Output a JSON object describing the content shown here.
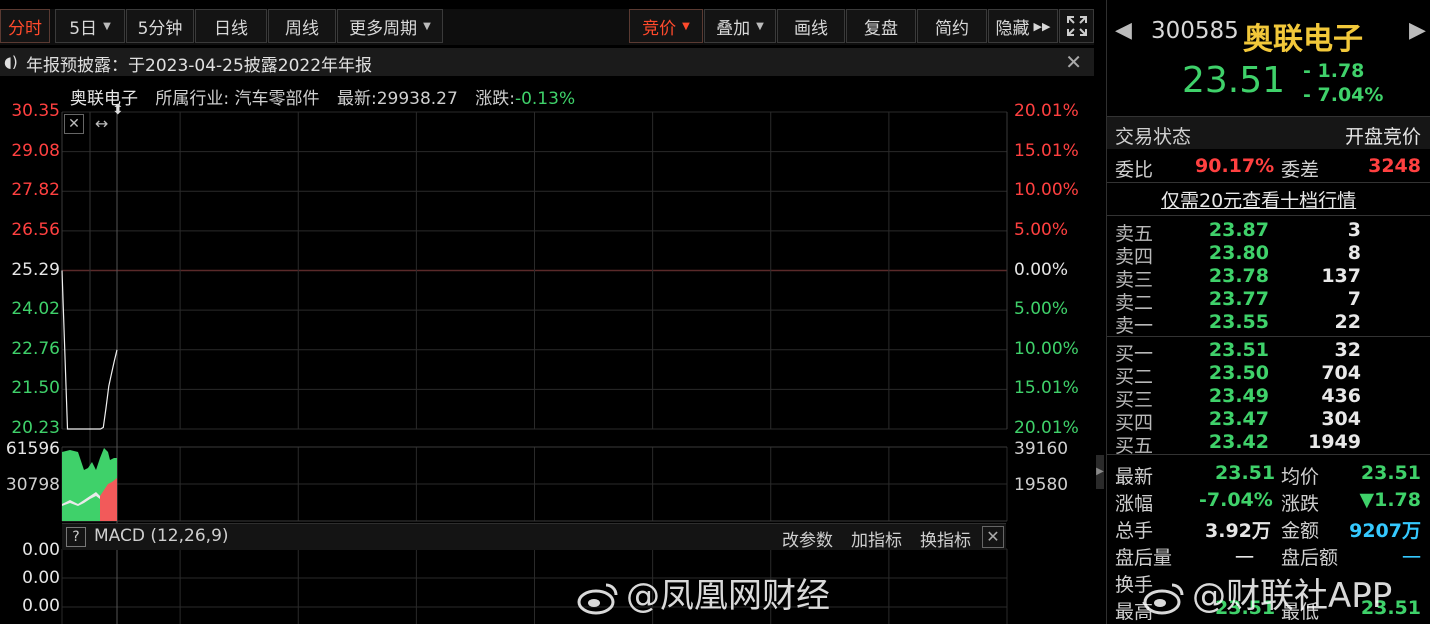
{
  "toolbar": {
    "tabs": [
      "分时",
      "5日",
      "5分钟",
      "日线",
      "周线",
      "更多周期"
    ],
    "right": [
      "竞价",
      "叠加",
      "画线",
      "复盘",
      "简约",
      "隐藏"
    ]
  },
  "notice": {
    "text": "年报预披露：于2023-04-25披露2022年年报"
  },
  "chart_header": {
    "name": "奥联电子",
    "industry_label": "所属行业:",
    "industry": "汽车零部件",
    "latest_label": "最新:",
    "latest": "29938.27",
    "change_label": "涨跌:",
    "change": "-0.13%"
  },
  "chart_data": [
    {
      "type": "line",
      "title": "",
      "y_left_ticks": [
        "30.35",
        "29.08",
        "27.82",
        "26.56",
        "25.29",
        "24.02",
        "22.76",
        "21.50",
        "20.23"
      ],
      "y_right_ticks": [
        "20.01%",
        "15.01%",
        "10.00%",
        "5.00%",
        "0.00%",
        "5.00%",
        "10.00%",
        "15.01%",
        "20.01%"
      ],
      "ylim": [
        20.23,
        30.35
      ],
      "series": [
        {
          "x": [
            0,
            0.02,
            0.04,
            0.06,
            0.08,
            0.1,
            0.11,
            0.12,
            0.13,
            0.14,
            0.15,
            0.16,
            0.17,
            0.18,
            0.19,
            0.2
          ],
          "values": [
            25.29,
            20.23,
            20.23,
            20.23,
            20.23,
            20.23,
            20.23,
            20.23,
            20.23,
            20.23,
            20.28,
            20.9,
            21.6,
            22.0,
            22.4,
            22.76
          ]
        }
      ]
    },
    {
      "type": "area",
      "title": "",
      "y_left_ticks": [
        "61596",
        "30798"
      ],
      "y_right_ticks": [
        "39160",
        "19580"
      ]
    },
    {
      "type": "line",
      "title": "MACD (12,26,9)",
      "y_left_ticks": [
        "0.00",
        "0.00",
        "0.00"
      ]
    }
  ],
  "macd": {
    "help": "?",
    "title": "MACD (12,26,9)",
    "buttons": [
      "改参数",
      "加指标",
      "换指标"
    ]
  },
  "panel": {
    "code": "300585",
    "name": "奥联电子",
    "price": "23.51",
    "change": "- 1.78",
    "change_pct": "- 7.04%",
    "status_label": "交易状态",
    "status": "开盘竞价",
    "weibi_label": "委比",
    "weibi": "90.17%",
    "weicha_label": "委差",
    "weicha": "3248",
    "promo": "仅需20元查看十档行情",
    "asks": [
      {
        "name": "卖五",
        "price": "23.87",
        "vol": "3"
      },
      {
        "name": "卖四",
        "price": "23.80",
        "vol": "8"
      },
      {
        "name": "卖三",
        "price": "23.78",
        "vol": "137"
      },
      {
        "name": "卖二",
        "price": "23.77",
        "vol": "7"
      },
      {
        "name": "卖一",
        "price": "23.55",
        "vol": "22"
      }
    ],
    "bids": [
      {
        "name": "买一",
        "price": "23.51",
        "vol": "32"
      },
      {
        "name": "买二",
        "price": "23.50",
        "vol": "704"
      },
      {
        "name": "买三",
        "price": "23.49",
        "vol": "436"
      },
      {
        "name": "买四",
        "price": "23.47",
        "vol": "304"
      },
      {
        "name": "买五",
        "price": "23.42",
        "vol": "1949"
      }
    ],
    "stats": {
      "latest_label": "最新",
      "latest": "23.51",
      "avg_label": "均价",
      "avg": "23.51",
      "amp_label": "涨幅",
      "amp": "-7.04%",
      "chg_label": "涨跌",
      "chg": "▼1.78",
      "vol_label": "总手",
      "vol": "3.92万",
      "amt_label": "金额",
      "amt": "9207万",
      "after_vol_label": "盘后量",
      "after_vol": "一",
      "after_amt_label": "盘后额",
      "after_amt": "一",
      "turn_label": "换手",
      "turn": "",
      "high_label": "最高",
      "high": "23.51",
      "low_label": "最低",
      "low": "23.51"
    }
  },
  "watermarks": [
    "@凤凰网财经",
    "@财联社APP"
  ],
  "colors": {
    "up": "#ff4040",
    "down": "#3fd16a",
    "accent": "#ff4a2c",
    "name": "#f2c83a"
  }
}
